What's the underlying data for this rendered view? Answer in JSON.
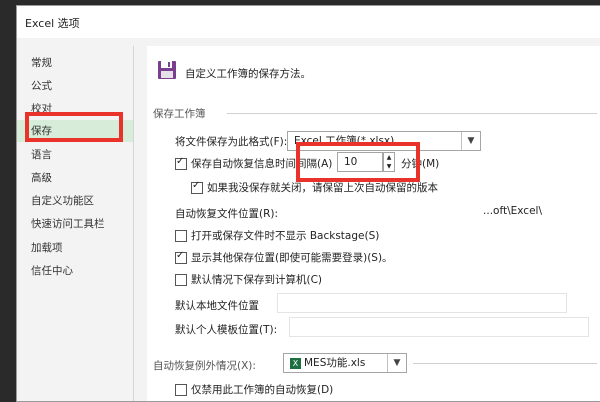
{
  "title": "Excel 选项",
  "sidebar": {
    "items": [
      {
        "label": "常规"
      },
      {
        "label": "公式"
      },
      {
        "label": "校对"
      },
      {
        "label": "保存"
      },
      {
        "label": "语言"
      },
      {
        "label": "高级"
      },
      {
        "label": "自定义功能区"
      },
      {
        "label": "快速访问工具栏"
      },
      {
        "label": "加载项"
      },
      {
        "label": "信任中心"
      }
    ]
  },
  "header": {
    "text": "自定义工作簿的保存方法。",
    "icon": "floppy-disk-icon"
  },
  "save_section": {
    "heading": "保存工作簿",
    "format_label": "将文件保存为此格式(F):",
    "format_value": "Excel 工作簿(*.xlsx)",
    "autorecover_label": "保存自动恢复信息时间间隔(A)",
    "autorecover_value": "10",
    "minutes_label": "分钟(M)",
    "keep_last_label": "如果我没保存就关闭，请保留上次自动保留的版本",
    "autorecover_location_label": "自动恢复文件位置(R):",
    "autorecover_location_value": "...oft\\Excel\\",
    "no_backstage_label": "打开或保存文件时不显示 Backstage(S)",
    "show_other_locations_label": "显示其他保存位置(即使可能需要登录)(S)。",
    "save_to_computer_label": "默认情况下保存到计算机(C)",
    "default_local_label": "默认本地文件位置",
    "default_template_label": "默认个人模板位置(T):"
  },
  "exceptions_section": {
    "heading": "自动恢复例外情况(X):",
    "workbook_value": "MES功能.xls",
    "disable_autorecover_label": "仅禁用此工作簿的自动恢复(D)"
  },
  "colors": {
    "accent": "#d7ecd9",
    "highlight": "#e8322a",
    "excel_green": "#1d6f42"
  }
}
